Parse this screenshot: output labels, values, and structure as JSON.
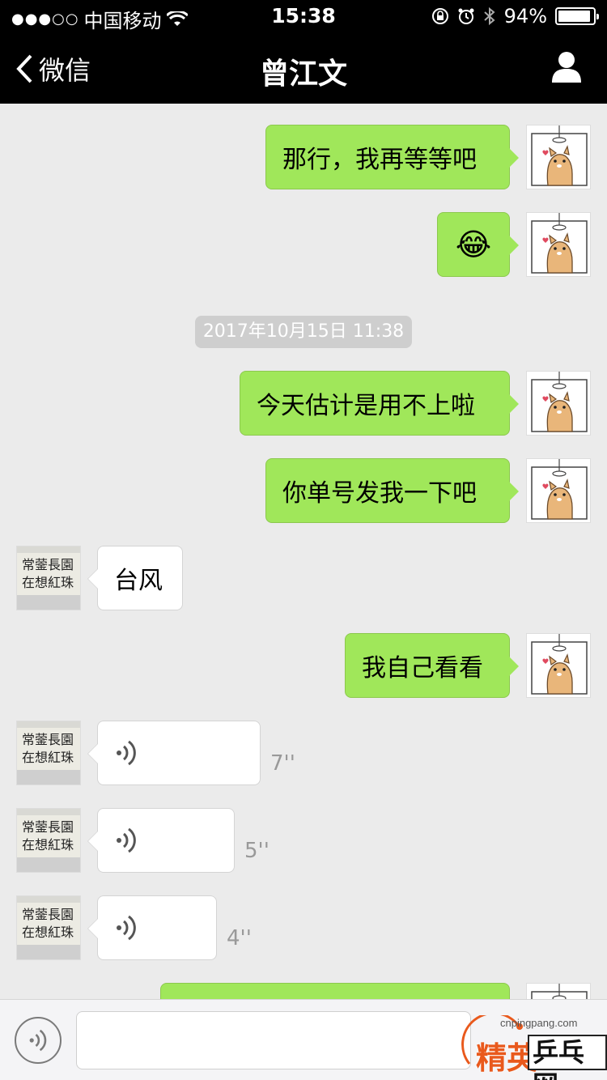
{
  "status_bar": {
    "signal": "●●●○○",
    "carrier": "中国移动",
    "time": "15:38",
    "battery_text": "94%",
    "battery_level": 0.94
  },
  "nav": {
    "back_label": "微信",
    "title": "曾江文"
  },
  "timestamp": "2017年10月15日 11:38",
  "messages": [
    {
      "side": "right",
      "text": "那行，我再等等吧"
    },
    {
      "side": "right",
      "emoji": "😂"
    },
    {
      "side": "right",
      "text": "今天估计是用不上啦"
    },
    {
      "side": "right",
      "text": "你单号发我一下吧"
    },
    {
      "side": "left",
      "text": "台风"
    },
    {
      "side": "right",
      "text": "我自己看看"
    },
    {
      "side": "left",
      "voice": true,
      "duration": "7''"
    },
    {
      "side": "left",
      "voice": true,
      "duration": "5''"
    },
    {
      "side": "left",
      "voice": true,
      "duration": "4''"
    }
  ],
  "left_avatar_calligraphy": "常蓥長園在想紅珠",
  "watermark": {
    "url": "cnpingpang.com",
    "brand_left": "精英",
    "brand_right": "乒乓网"
  },
  "colors": {
    "sent_bubble": "#a0e75a",
    "received_bubble": "#ffffff",
    "background": "#ebebeb",
    "header": "#000000"
  }
}
